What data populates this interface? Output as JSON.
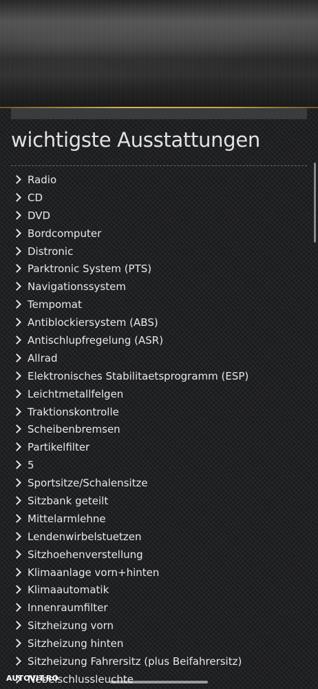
{
  "section": {
    "title": "wichtigste Ausstattungen"
  },
  "features": [
    "Radio",
    "CD",
    "DVD",
    "Bordcomputer",
    "Distronic",
    "Parktronic System (PTS)",
    "Navigationssystem",
    "Tempomat",
    "Antiblockiersystem (ABS)",
    "Antischlupfregelung (ASR)",
    "Allrad",
    "Elektronisches Stabilitaetsprogramm (ESP)",
    "Leichtmetallfelgen",
    "Traktionskontrolle",
    "Scheibenbremsen",
    "Partikelfilter",
    "5",
    "Sportsitze/Schalensitze",
    "Sitzbank geteilt",
    "Mittelarmlehne",
    "Lendenwirbelstuetzen",
    "Sitzhoehenverstellung",
    "Klimaanlage vorn+hinten",
    "Klimaautomatik",
    "Innenraumfilter",
    "Sitzheizung vorn",
    "Sitzheizung hinten",
    "Sitzheizung Fahrersitz (plus Beifahrersitz)",
    "Nebelschlussleuchte"
  ],
  "watermark": {
    "text": "AUTOVIT.RO"
  },
  "icons": {
    "list_marker": "chevron-right-icon"
  },
  "colors": {
    "accent_gold": "#c9a64a",
    "text": "#e8e8e8",
    "background": "#1f2022"
  }
}
